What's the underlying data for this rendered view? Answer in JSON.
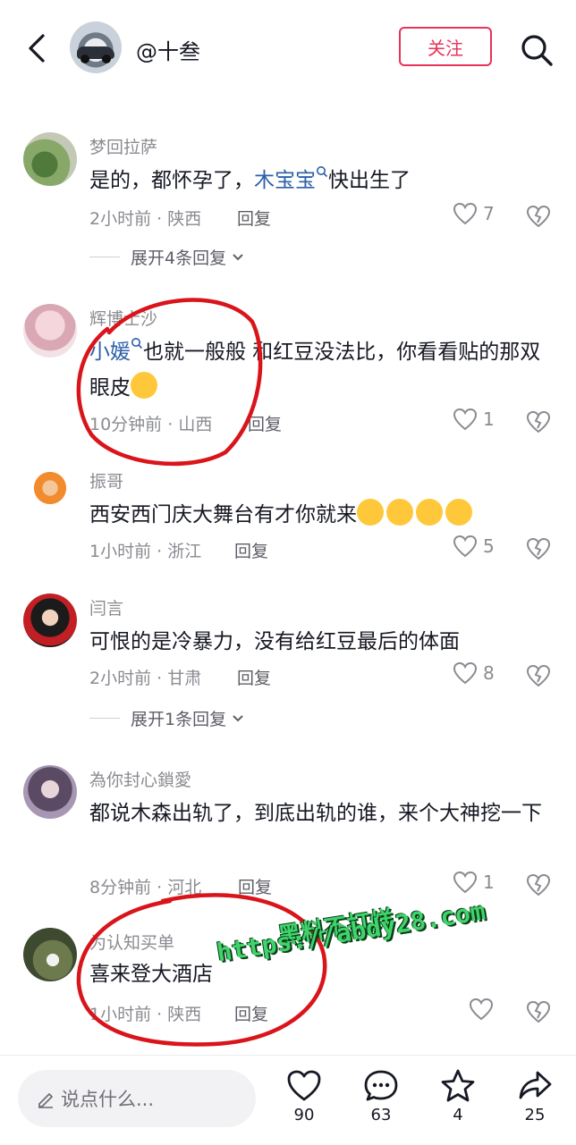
{
  "header": {
    "username": "@十叁",
    "follow_label": "关注"
  },
  "comments": [
    {
      "username": "梦回拉萨",
      "text_before": "是的，都怀孕了，",
      "mention": "木宝宝",
      "text_after": "快出生了",
      "time": "2小时前",
      "location": "陕西",
      "reply_label": "回复",
      "likes": "7",
      "expand_label": "展开4条回复"
    },
    {
      "username": "辉博士沙",
      "mention": "小媛",
      "text": "也就一般般  和红豆没法比，你看看贴的那双眼皮",
      "time": "10分钟前",
      "location": "山西",
      "reply_label": "回复",
      "likes": "1"
    },
    {
      "username": "振哥",
      "text": "西安西门庆大舞台有才你就来",
      "time": "1小时前",
      "location": "浙江",
      "reply_label": "回复",
      "likes": "5"
    },
    {
      "username": "闫言",
      "text": "可恨的是冷暴力，没有给红豆最后的体面",
      "time": "2小时前",
      "location": "甘肃",
      "reply_label": "回复",
      "likes": "8",
      "expand_label": "展开1条回复"
    },
    {
      "username": "為你封心鎖愛",
      "text": "都说木森出轨了，到底出轨的谁，来个大神挖一下",
      "time": "8分钟前",
      "location": "河北",
      "reply_label": "回复",
      "likes": "1"
    },
    {
      "username": "为认知买单",
      "text": "喜来登大酒店",
      "time": "1小时前",
      "location": "陕西",
      "reply_label": "回复"
    }
  ],
  "watermark": {
    "line1": "黑料不打烊",
    "line2": "https://abdy28.com"
  },
  "bottom_bar": {
    "input_placeholder": "说点什么...",
    "like_count": "90",
    "comment_count": "63",
    "favorite_count": "4",
    "share_count": "25"
  },
  "colors": {
    "accent": "#e8335a",
    "mention": "#2c5fa8",
    "annotation": "#d9141b",
    "watermark": "#3fd46a"
  }
}
